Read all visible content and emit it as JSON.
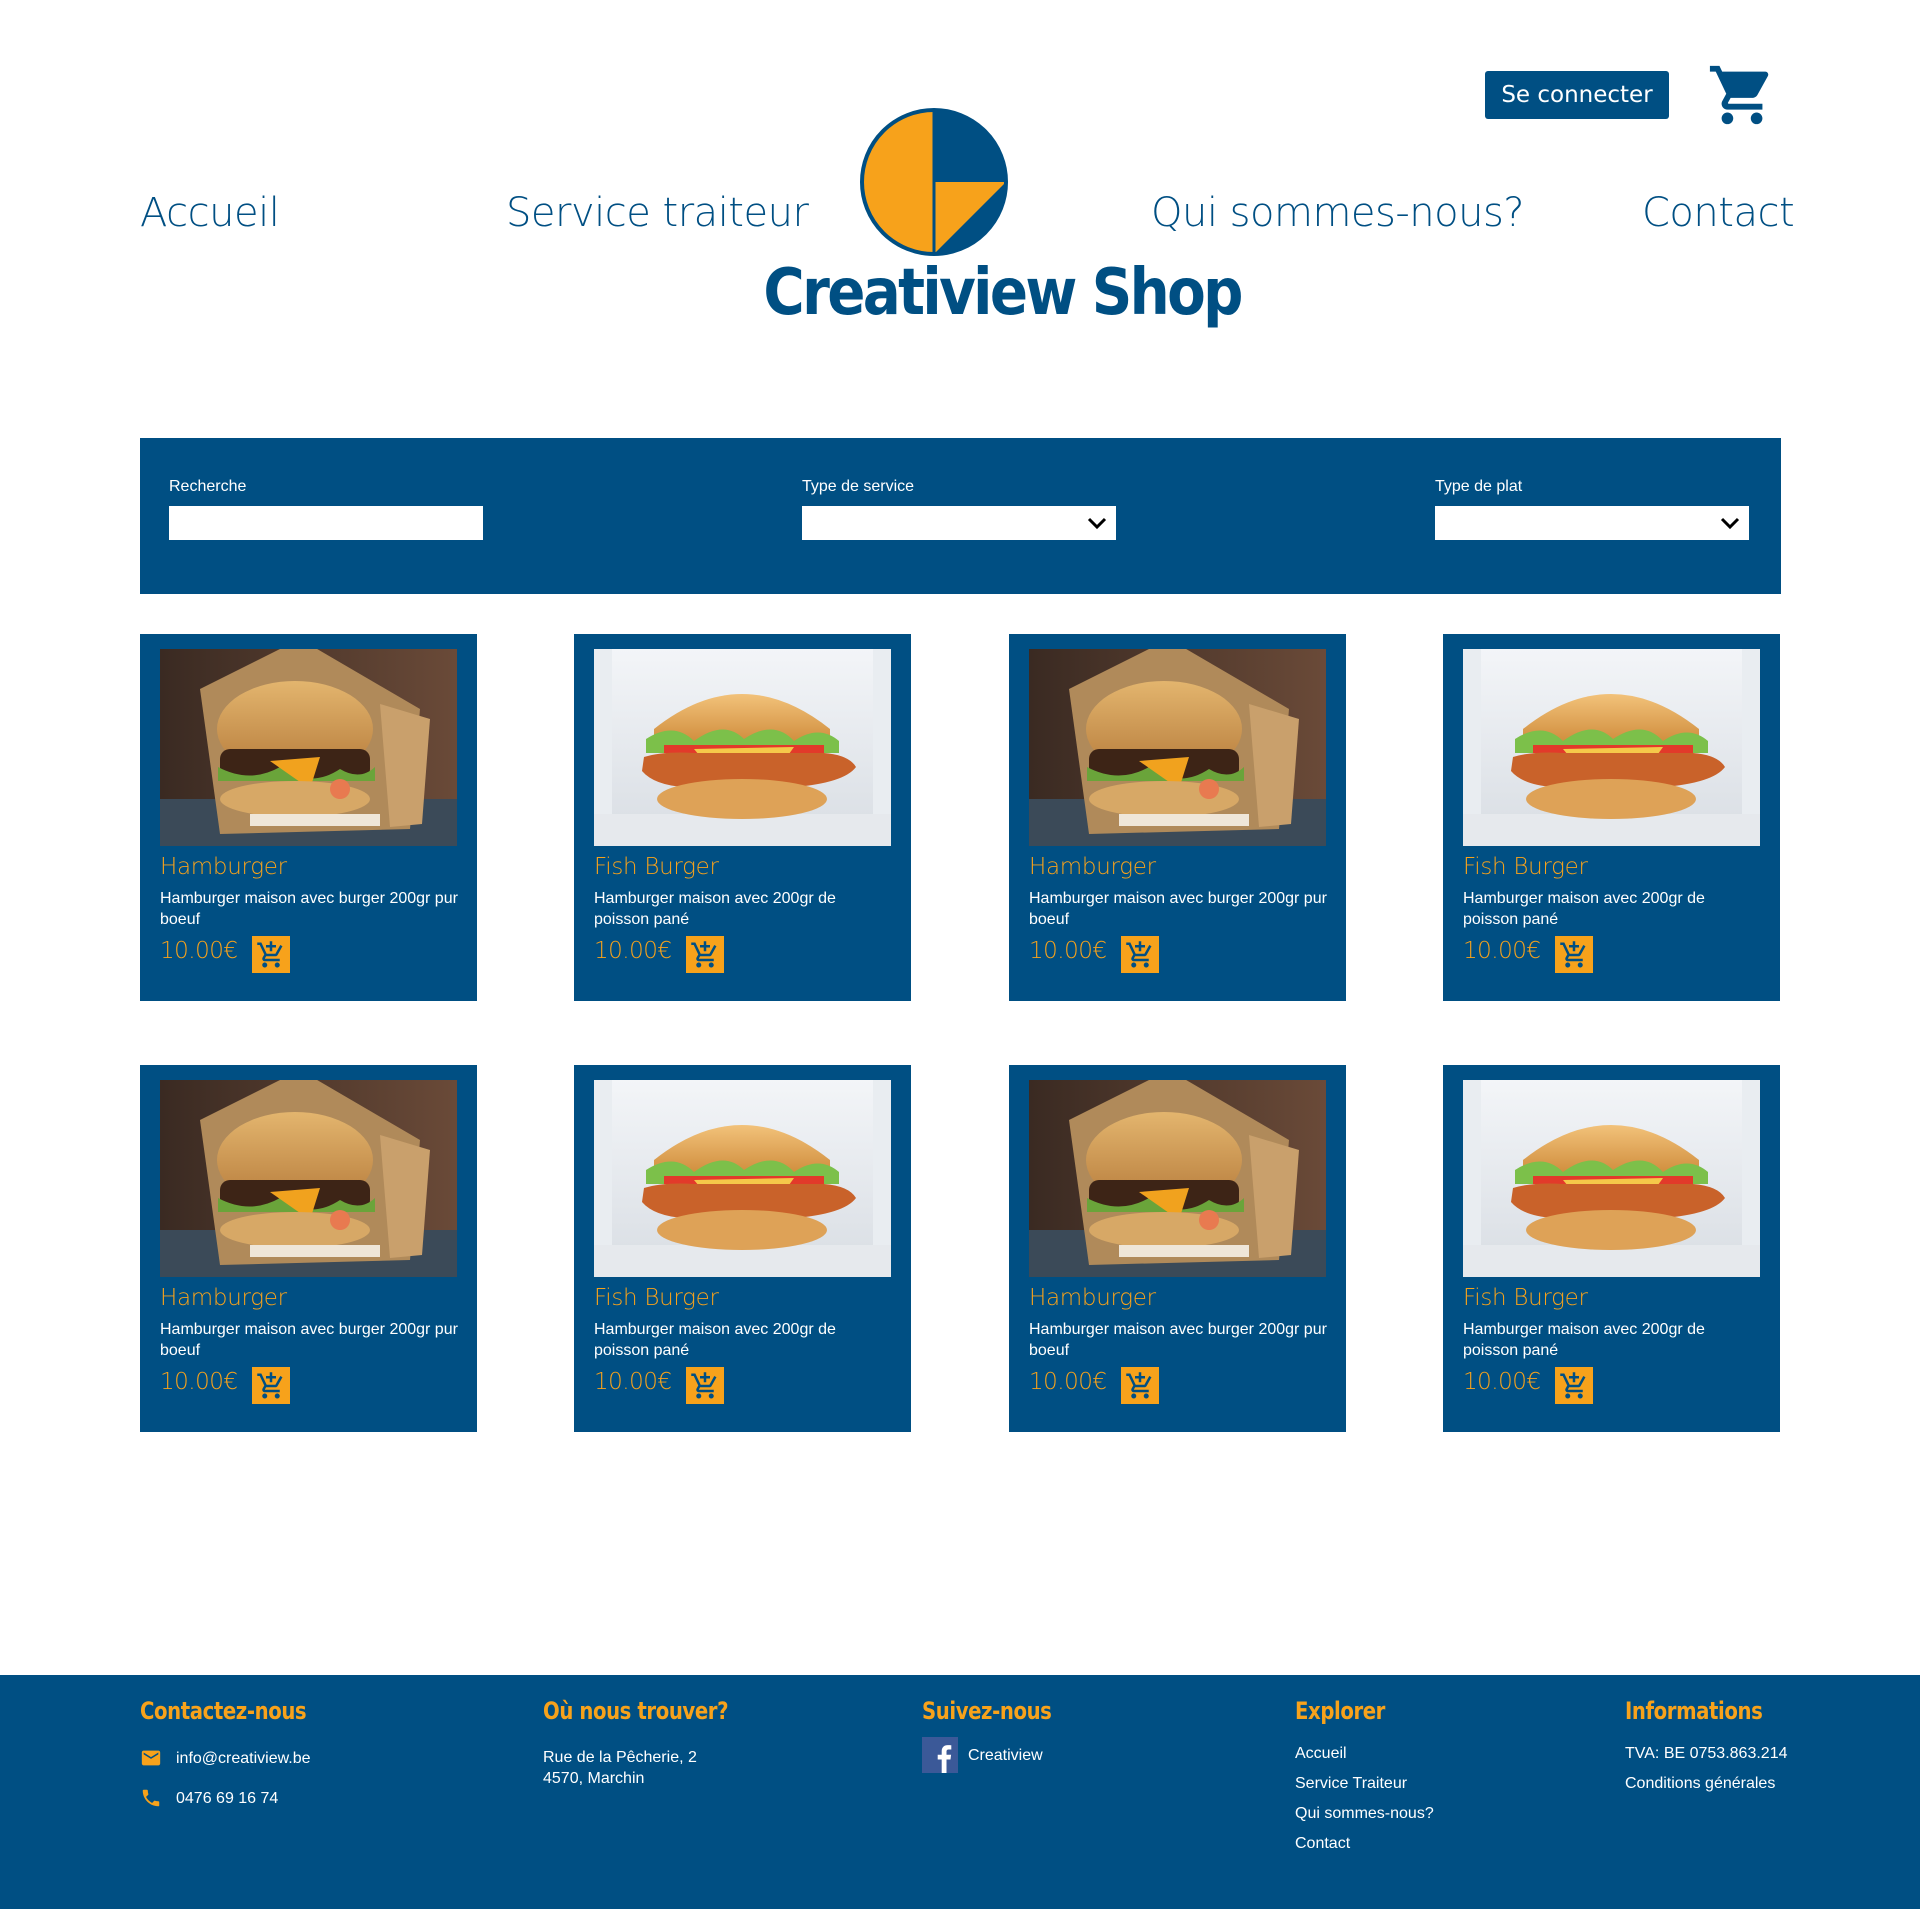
{
  "header": {
    "login_label": "Se connecter",
    "brand": "Creatiview Shop",
    "nav": [
      "Accueil",
      "Service traiteur",
      "Qui sommes-nous?",
      "Contact"
    ],
    "cart_icon": "cart-icon"
  },
  "filters": {
    "search_label": "Recherche",
    "search_value": "",
    "service_label": "Type de service",
    "service_value": "",
    "dish_label": "Type de plat",
    "dish_value": ""
  },
  "products": [
    {
      "name": "Hamburger",
      "desc": "Hamburger maison avec burger 200gr pur boeuf",
      "price": "10.00€",
      "image": "hamburger"
    },
    {
      "name": "Fish Burger",
      "desc": "Hamburger maison avec 200gr de poisson pané",
      "price": "10.00€",
      "image": "fish-burger"
    },
    {
      "name": "Hamburger",
      "desc": "Hamburger maison avec burger 200gr pur boeuf",
      "price": "10.00€",
      "image": "hamburger"
    },
    {
      "name": "Fish Burger",
      "desc": "Hamburger maison avec 200gr de poisson pané",
      "price": "10.00€",
      "image": "fish-burger"
    },
    {
      "name": "Hamburger",
      "desc": "Hamburger maison avec burger 200gr pur boeuf",
      "price": "10.00€",
      "image": "hamburger"
    },
    {
      "name": "Fish Burger",
      "desc": "Hamburger maison avec 200gr de poisson pané",
      "price": "10.00€",
      "image": "fish-burger"
    },
    {
      "name": "Hamburger",
      "desc": "Hamburger maison avec burger 200gr pur boeuf",
      "price": "10.00€",
      "image": "hamburger"
    },
    {
      "name": "Fish Burger",
      "desc": "Hamburger maison avec 200gr de poisson pané",
      "price": "10.00€",
      "image": "fish-burger"
    }
  ],
  "footer": {
    "contact": {
      "title": "Contactez-nous",
      "email": "info@creatiview.be",
      "phone": "0476 69 16 74"
    },
    "location": {
      "title": "Où nous trouver?",
      "line1": "Rue de la Pêcherie, 2",
      "line2": "4570, Marchin"
    },
    "social": {
      "title": "Suivez-nous",
      "facebook": "Creatiview"
    },
    "explore": {
      "title": "Explorer",
      "links": [
        "Accueil",
        "Service Traiteur",
        "Qui sommes-nous?",
        "Contact"
      ]
    },
    "info": {
      "title": "Informations",
      "vat": "TVA: BE 0753.863.214",
      "terms": "Conditions générales"
    }
  },
  "colors": {
    "brand_blue": "#004f83",
    "accent_orange": "#f7a21b",
    "background": "#ffffff"
  }
}
